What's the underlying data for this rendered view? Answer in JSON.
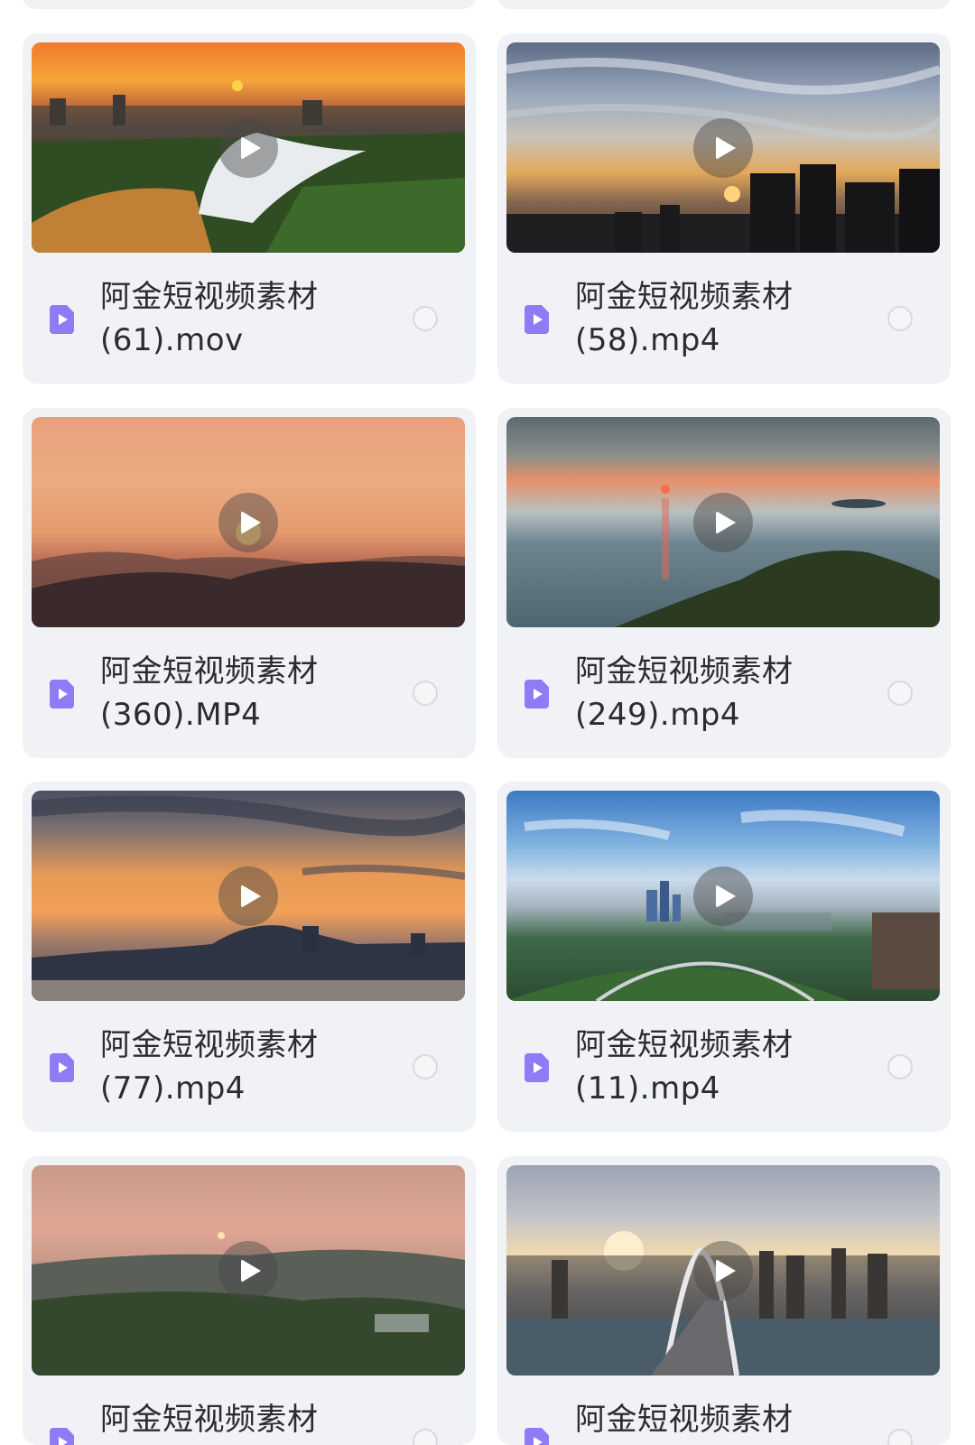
{
  "icons": {
    "play": "play-icon",
    "file": "video-file-icon",
    "select": "radio-circle-icon"
  },
  "colors": {
    "card_bg": "#f1f2f6",
    "file_icon": "#8d7cf5",
    "text": "#2b2b30"
  },
  "items": [
    {
      "name": "阿金短视频素材\n(61).mov"
    },
    {
      "name": "阿金短视频素材\n(58).mp4"
    },
    {
      "name": "阿金短视频素材\n(360).MP4"
    },
    {
      "name": "阿金短视频素材\n(249).mp4"
    },
    {
      "name": "阿金短视频素材\n(77).mp4"
    },
    {
      "name": "阿金短视频素材\n(11).mp4"
    },
    {
      "name": "阿金短视频素材"
    },
    {
      "name": "阿金短视频素材"
    }
  ]
}
